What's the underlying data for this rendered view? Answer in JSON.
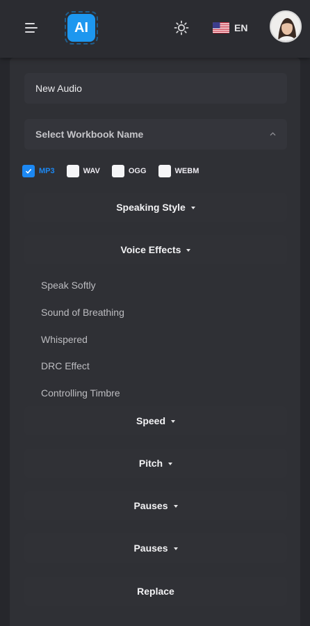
{
  "header": {
    "logo_text": "AI",
    "language": "EN",
    "accent_color": "#1d97ef"
  },
  "form": {
    "title_value": "New Audio",
    "workbook_select": "Select Workbook Name",
    "formats": [
      {
        "label": "MP3",
        "checked": true
      },
      {
        "label": "WAV",
        "checked": false
      },
      {
        "label": "OGG",
        "checked": false
      },
      {
        "label": "WEBM",
        "checked": false
      }
    ],
    "speaking_style": "Speaking Style",
    "voice_effects": "Voice Effects",
    "voice_effect_options": [
      "Speak Softly",
      "Sound of Breathing",
      "Whispered",
      "DRC Effect",
      "Controlling Timbre"
    ],
    "speed": "Speed",
    "pitch": "Pitch",
    "pauses_1": "Pauses",
    "pauses_2": "Pauses",
    "replace": "Replace"
  }
}
